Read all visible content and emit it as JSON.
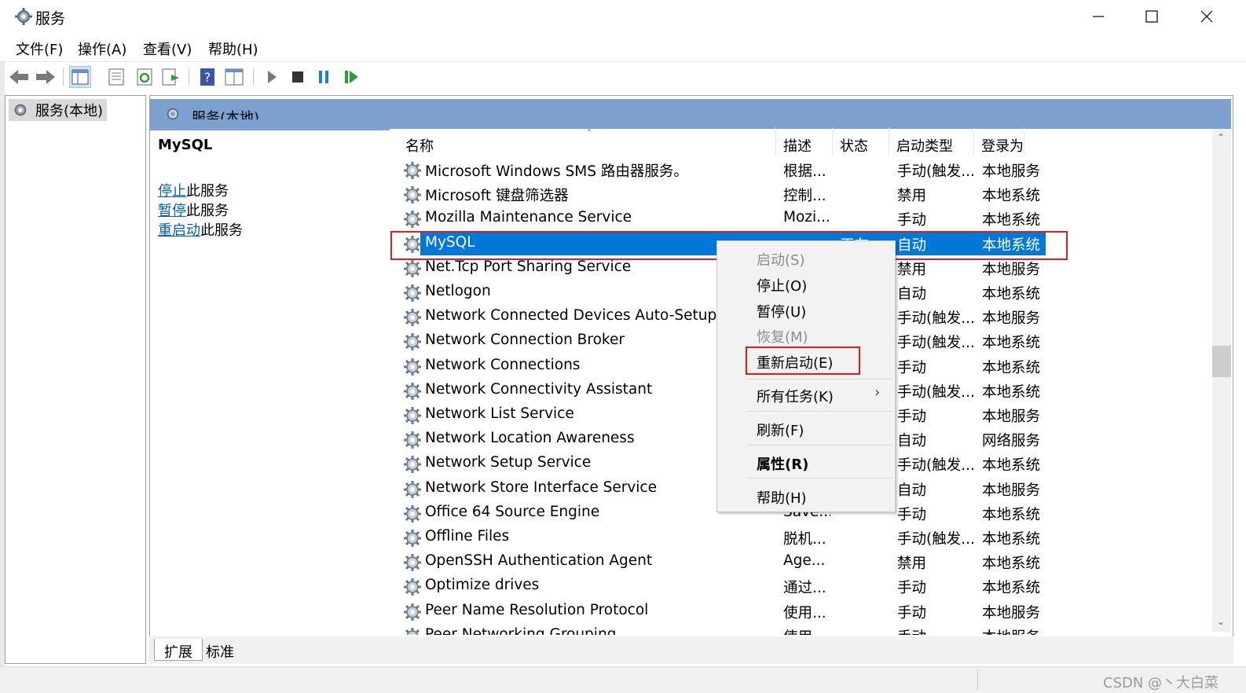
{
  "window": {
    "title": "服务"
  },
  "menu": [
    "文件(F)",
    "操作(A)",
    "查看(V)",
    "帮助(H)"
  ],
  "toolbar_icons": [
    "back-arrow-icon",
    "forward-arrow-icon",
    "console-tree-icon",
    "properties-icon",
    "refresh-icon",
    "export-list-icon",
    "help-icon",
    "extended-view-icon",
    "start-service-icon",
    "stop-service-icon",
    "pause-service-icon",
    "resume-service-icon"
  ],
  "left_pane": {
    "item": "服务(本地)"
  },
  "main": {
    "header": "服务(本地)",
    "selected_service": "MySQL",
    "actions": [
      {
        "link": "停止",
        "text": "此服务"
      },
      {
        "link": "暂停",
        "text": "此服务"
      },
      {
        "link": "重启动",
        "text": "此服务"
      }
    ]
  },
  "table": {
    "columns": [
      "名称",
      "描述",
      "状态",
      "启动类型",
      "登录为"
    ],
    "rows": [
      {
        "name": "Microsoft Windows SMS 路由器服务。",
        "desc": "根据...",
        "status": "",
        "startup": "手动(触发...",
        "logon": "本地服务"
      },
      {
        "name": "Microsoft 键盘筛选器",
        "desc": "控制...",
        "status": "",
        "startup": "禁用",
        "logon": "本地系统"
      },
      {
        "name": "Mozilla Maintenance Service",
        "desc": "Mozi...",
        "status": "",
        "startup": "手动",
        "logon": "本地系统"
      },
      {
        "name": "MySQL",
        "desc": "",
        "status": "正在...",
        "startup": "自动",
        "logon": "本地系统"
      },
      {
        "name": "Net.Tcp Port Sharing Service",
        "desc": "",
        "status": "",
        "startup": "禁用",
        "logon": "本地服务"
      },
      {
        "name": "Netlogon",
        "desc": "",
        "status": "",
        "startup": "自动",
        "logon": "本地系统"
      },
      {
        "name": "Network Connected Devices Auto-Setup",
        "desc": "",
        "status": "",
        "startup": "手动(触发...",
        "logon": "本地服务"
      },
      {
        "name": "Network Connection Broker",
        "desc": "",
        "status": "",
        "startup": "手动(触发...",
        "logon": "本地系统"
      },
      {
        "name": "Network Connections",
        "desc": "",
        "status": "",
        "startup": "手动",
        "logon": "本地系统"
      },
      {
        "name": "Network Connectivity Assistant",
        "desc": "",
        "status": "",
        "startup": "手动(触发...",
        "logon": "本地系统"
      },
      {
        "name": "Network List Service",
        "desc": "",
        "status": "",
        "startup": "手动",
        "logon": "本地服务"
      },
      {
        "name": "Network Location Awareness",
        "desc": "",
        "status": "",
        "startup": "自动",
        "logon": "网络服务"
      },
      {
        "name": "Network Setup Service",
        "desc": "",
        "status": "",
        "startup": "手动(触发...",
        "logon": "本地系统"
      },
      {
        "name": "Network Store Interface Service",
        "desc": "",
        "status": "",
        "startup": "自动",
        "logon": "本地服务"
      },
      {
        "name": "Office 64 Source Engine",
        "desc": "Save...",
        "status": "",
        "startup": "手动",
        "logon": "本地系统"
      },
      {
        "name": "Offline Files",
        "desc": "脱机...",
        "status": "",
        "startup": "手动(触发...",
        "logon": "本地系统"
      },
      {
        "name": "OpenSSH Authentication Agent",
        "desc": "Age...",
        "status": "",
        "startup": "禁用",
        "logon": "本地系统"
      },
      {
        "name": "Optimize drives",
        "desc": "通过...",
        "status": "",
        "startup": "手动",
        "logon": "本地系统"
      },
      {
        "name": "Peer Name Resolution Protocol",
        "desc": "使用...",
        "status": "",
        "startup": "手动",
        "logon": "本地服务"
      },
      {
        "name": "Peer Networking Grouping",
        "desc": "使用...",
        "status": "",
        "startup": "手动",
        "logon": "本地服务"
      }
    ]
  },
  "context_menu": {
    "start": "启动(S)",
    "stop": "停止(O)",
    "pause": "暂停(U)",
    "resume": "恢复(M)",
    "restart": "重新启动(E)",
    "all_tasks": "所有任务(K)",
    "submenu_arrow": "›",
    "refresh": "刷新(F)",
    "properties": "属性(R)",
    "help": "帮助(H)"
  },
  "tabs": [
    "扩展",
    "标准"
  ],
  "status": {
    "watermark": "CSDN @丶大白菜"
  },
  "colors": {
    "selection": "#0078d7",
    "header": "#7da1cf",
    "highlight_box": "#e21b1b",
    "link": "#0a5fb4"
  }
}
